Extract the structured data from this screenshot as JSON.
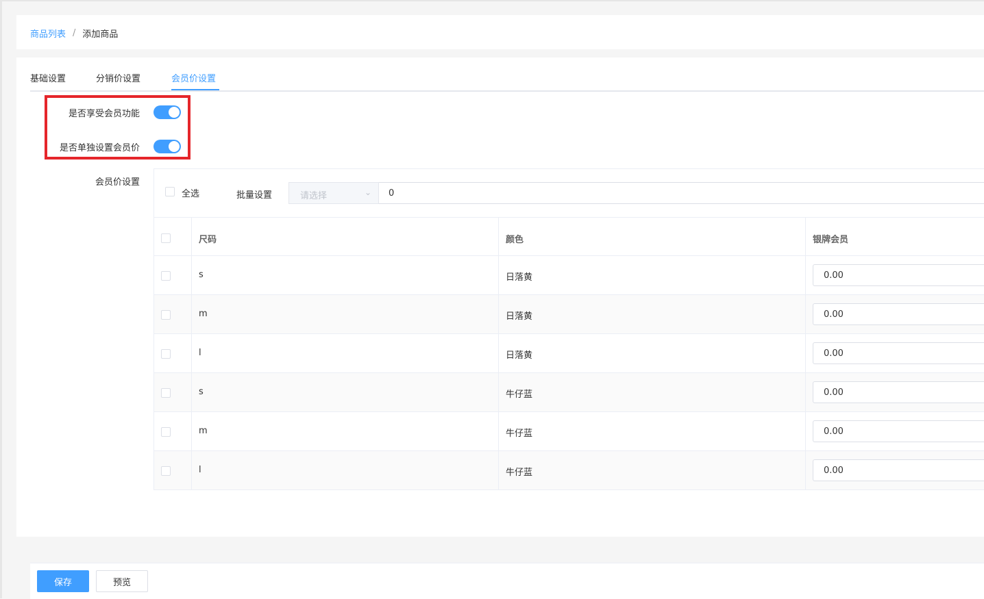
{
  "breadcrumb": {
    "parent": "商品列表",
    "separator": "/",
    "current": "添加商品"
  },
  "tabs": [
    {
      "label": "基础设置",
      "active": false
    },
    {
      "label": "分销价设置",
      "active": false
    },
    {
      "label": "会员价设置",
      "active": true
    }
  ],
  "form": {
    "enable_member_label": "是否享受会员功能",
    "enable_member_on": true,
    "separate_price_label": "是否单独设置会员价",
    "separate_price_on": true,
    "member_price_label": "会员价设置"
  },
  "toolbar": {
    "select_all_label": "全选",
    "batch_label": "批量设置",
    "select_placeholder": "请选择",
    "batch_value": "0"
  },
  "table": {
    "headers": {
      "size": "尺码",
      "color": "颜色",
      "silver": "银牌会员"
    },
    "rows": [
      {
        "size": "s",
        "color": "日落黄",
        "silver": "0.00"
      },
      {
        "size": "m",
        "color": "日落黄",
        "silver": "0.00"
      },
      {
        "size": "l",
        "color": "日落黄",
        "silver": "0.00"
      },
      {
        "size": "s",
        "color": "牛仔蓝",
        "silver": "0.00"
      },
      {
        "size": "m",
        "color": "牛仔蓝",
        "silver": "0.00"
      },
      {
        "size": "l",
        "color": "牛仔蓝",
        "silver": "0.00"
      }
    ]
  },
  "footer": {
    "save_label": "保存",
    "preview_label": "预览"
  },
  "colors": {
    "primary": "#409eff",
    "highlight": "#e5262b"
  }
}
